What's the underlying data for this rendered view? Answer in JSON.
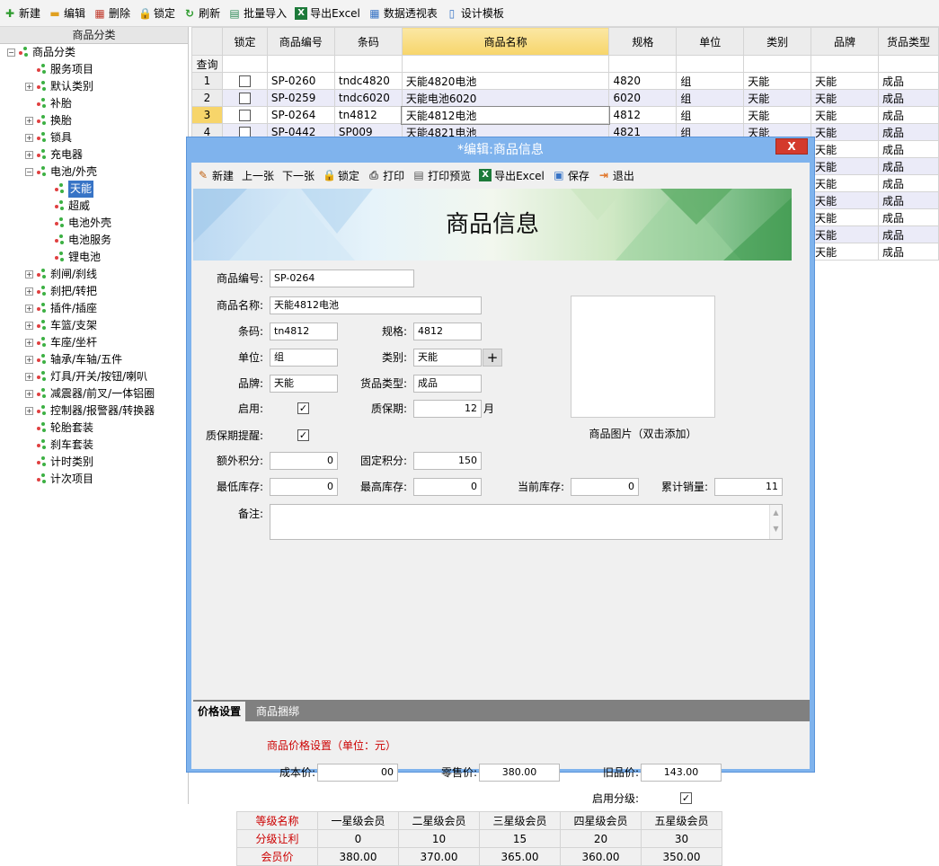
{
  "toolbar": [
    {
      "label": "新建",
      "icon": "plus-icon",
      "color": "#2e9b2e"
    },
    {
      "label": "编辑",
      "icon": "folder-icon",
      "color": "#e0a020"
    },
    {
      "label": "删除",
      "icon": "grid-delete-icon",
      "color": "#c0392b"
    },
    {
      "label": "锁定",
      "icon": "lock-icon",
      "color": "#e0a020"
    },
    {
      "label": "刷新",
      "icon": "refresh-icon",
      "color": "#2e9b2e"
    },
    {
      "label": "批量导入",
      "icon": "import-icon",
      "color": "#2e8b57"
    },
    {
      "label": "导出Excel",
      "icon": "excel-icon",
      "color": "#1d7a3a"
    },
    {
      "label": "数据透视表",
      "icon": "pivot-icon",
      "color": "#3874c6"
    },
    {
      "label": "设计模板",
      "icon": "template-icon",
      "color": "#3874c6"
    }
  ],
  "tree": {
    "header": "商品分类",
    "nodes": [
      {
        "label": "商品分类",
        "level": 0,
        "exp": "−"
      },
      {
        "label": "服务项目",
        "level": 1,
        "exp": ""
      },
      {
        "label": "默认类别",
        "level": 1,
        "exp": "+"
      },
      {
        "label": "补胎",
        "level": 1,
        "exp": ""
      },
      {
        "label": "换胎",
        "level": 1,
        "exp": "+"
      },
      {
        "label": "锁具",
        "level": 1,
        "exp": "+"
      },
      {
        "label": "充电器",
        "level": 1,
        "exp": "+"
      },
      {
        "label": "电池/外壳",
        "level": 1,
        "exp": "−"
      },
      {
        "label": "天能",
        "level": 2,
        "exp": "",
        "selected": true
      },
      {
        "label": "超威",
        "level": 2,
        "exp": ""
      },
      {
        "label": "电池外壳",
        "level": 2,
        "exp": ""
      },
      {
        "label": "电池服务",
        "level": 2,
        "exp": ""
      },
      {
        "label": "锂电池",
        "level": 2,
        "exp": ""
      },
      {
        "label": "刹闸/刹线",
        "level": 1,
        "exp": "+"
      },
      {
        "label": "刹把/转把",
        "level": 1,
        "exp": "+"
      },
      {
        "label": "插件/插座",
        "level": 1,
        "exp": "+"
      },
      {
        "label": "车篮/支架",
        "level": 1,
        "exp": "+"
      },
      {
        "label": "车座/坐杆",
        "level": 1,
        "exp": "+"
      },
      {
        "label": "轴承/车轴/五件",
        "level": 1,
        "exp": "+"
      },
      {
        "label": "灯具/开关/按钮/喇叭",
        "level": 1,
        "exp": "+"
      },
      {
        "label": "减震器/前叉/一体铝圈",
        "level": 1,
        "exp": "+"
      },
      {
        "label": "控制器/报警器/转换器",
        "level": 1,
        "exp": "+"
      },
      {
        "label": "轮胎套装",
        "level": 1,
        "exp": ""
      },
      {
        "label": "刹车套装",
        "level": 1,
        "exp": ""
      },
      {
        "label": "计时类别",
        "level": 1,
        "exp": ""
      },
      {
        "label": "计次项目",
        "level": 1,
        "exp": ""
      }
    ]
  },
  "grid": {
    "columns": [
      "锁定",
      "商品编号",
      "条码",
      "商品名称",
      "规格",
      "单位",
      "类别",
      "品牌",
      "货品类型"
    ],
    "query_label": "查询",
    "rows": [
      {
        "num": "1",
        "code": "SP-0260",
        "barcode": "tndc4820",
        "name": "天能4820电池",
        "spec": "4820",
        "unit": "组",
        "cat": "天能",
        "brand": "天能",
        "type": "成品"
      },
      {
        "num": "2",
        "code": "SP-0259",
        "barcode": "tndc6020",
        "name": "天能电池6020",
        "spec": "6020",
        "unit": "组",
        "cat": "天能",
        "brand": "天能",
        "type": "成品"
      },
      {
        "num": "3",
        "code": "SP-0264",
        "barcode": "tn4812",
        "name": "天能4812电池",
        "spec": "4812",
        "unit": "组",
        "cat": "天能",
        "brand": "天能",
        "type": "成品"
      },
      {
        "num": "4",
        "code": "SP-0442",
        "barcode": "SP009",
        "name": "天能4821电池",
        "spec": "4821",
        "unit": "组",
        "cat": "天能",
        "brand": "天能",
        "type": "成品"
      },
      {
        "num": "",
        "code": "",
        "barcode": "",
        "name": "",
        "spec": "",
        "unit": "",
        "cat": "",
        "brand": "天能",
        "type": "成品"
      },
      {
        "num": "",
        "code": "",
        "barcode": "",
        "name": "",
        "spec": "",
        "unit": "",
        "cat": "",
        "brand": "天能",
        "type": "成品"
      },
      {
        "num": "",
        "code": "",
        "barcode": "",
        "name": "",
        "spec": "",
        "unit": "",
        "cat": "",
        "brand": "天能",
        "type": "成品"
      },
      {
        "num": "",
        "code": "",
        "barcode": "",
        "name": "",
        "spec": "",
        "unit": "",
        "cat": "",
        "brand": "天能",
        "type": "成品"
      },
      {
        "num": "",
        "code": "",
        "barcode": "",
        "name": "",
        "spec": "",
        "unit": "",
        "cat": "",
        "brand": "天能",
        "type": "成品"
      },
      {
        "num": "",
        "code": "",
        "barcode": "",
        "name": "",
        "spec": "",
        "unit": "",
        "cat": "",
        "brand": "天能",
        "type": "成品"
      },
      {
        "num": "",
        "code": "",
        "barcode": "",
        "name": "",
        "spec": "",
        "unit": "",
        "cat": "",
        "brand": "天能",
        "type": "成品"
      }
    ]
  },
  "dialog": {
    "title": "*编辑:商品信息",
    "close": "X",
    "toolbar": [
      {
        "label": "新建",
        "icon": "new-doc-icon"
      },
      {
        "label": "上一张",
        "icon": ""
      },
      {
        "label": "下一张",
        "icon": ""
      },
      {
        "label": "锁定",
        "icon": "lock-icon"
      },
      {
        "label": "打印",
        "icon": "printer-icon"
      },
      {
        "label": "打印预览",
        "icon": "print-preview-icon"
      },
      {
        "label": "导出Excel",
        "icon": "excel-icon"
      },
      {
        "label": "保存",
        "icon": "save-icon"
      },
      {
        "label": "退出",
        "icon": "exit-icon"
      }
    ],
    "banner_title": "商品信息",
    "form": {
      "code_label": "商品编号:",
      "code": "SP-0264",
      "name_label": "商品名称:",
      "name": "天能4812电池",
      "barcode_label": "条码:",
      "barcode": "tn4812",
      "spec_label": "规格:",
      "spec": "4812",
      "unit_label": "单位:",
      "unit": "组",
      "cat_label": "类别:",
      "cat": "天能",
      "cat_add": "+",
      "brand_label": "品牌:",
      "brand": "天能",
      "type_label": "货品类型:",
      "type": "成品",
      "enable_label": "启用:",
      "enable_checked": true,
      "warranty_label": "质保期:",
      "warranty": "12",
      "warranty_unit": "月",
      "warranty_remind_label": "质保期提醒:",
      "warranty_remind_checked": true,
      "image_caption": "商品图片（双击添加）",
      "extra_points_label": "额外积分:",
      "extra_points": "0",
      "fixed_points_label": "固定积分:",
      "fixed_points": "150",
      "min_stock_label": "最低库存:",
      "min_stock": "0",
      "max_stock_label": "最高库存:",
      "max_stock": "0",
      "cur_stock_label": "当前库存:",
      "cur_stock": "0",
      "total_sales_label": "累计销量:",
      "total_sales": "11",
      "remark_label": "备注:"
    },
    "tabs": [
      {
        "label": "价格设置",
        "active": true
      },
      {
        "label": "商品捆绑",
        "active": false
      }
    ],
    "price": {
      "title": "商品价格设置（单位：元）",
      "cost_label": "成本价:",
      "cost": "00",
      "retail_label": "零售价:",
      "retail": "380.00",
      "old_label": "旧品价:",
      "old": "143.00",
      "level_enable_label": "启用分级:",
      "level_enable_checked": true,
      "level_header": [
        "等级名称",
        "一星级会员",
        "二星级会员",
        "三星级会员",
        "四星级会员",
        "五星级会员"
      ],
      "level_discount": [
        "分级让利",
        "0",
        "10",
        "15",
        "20",
        "30"
      ],
      "level_price": [
        "会员价",
        "380.00",
        "370.00",
        "365.00",
        "360.00",
        "350.00"
      ]
    }
  }
}
